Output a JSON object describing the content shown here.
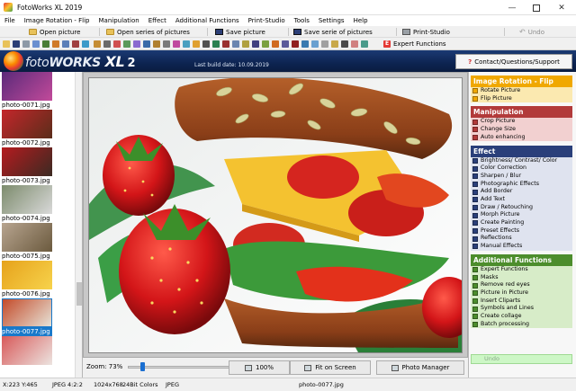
{
  "window": {
    "title": "FotoWorks XL 2019",
    "controls": {
      "minimize": "—",
      "close": "✕"
    }
  },
  "menu": [
    "File",
    "Image Rotation - Flip",
    "Manipulation",
    "Effect",
    "Additional Functions",
    "Print-Studio",
    "Tools",
    "Settings",
    "Help"
  ],
  "toolbar": {
    "open_picture": "Open picture",
    "open_series": "Open series of pictures",
    "save_picture": "Save picture",
    "save_series": "Save serie of pictures",
    "print_studio": "Print-Studio",
    "undo": "Undo",
    "expert_functions": "Expert Functions"
  },
  "banner": {
    "logo_foto": "foto",
    "logo_works": "WORKS",
    "logo_xl": "XL",
    "logo_version": "2",
    "build_date": "Last build date: 10.09.2019",
    "contact_label": "Contact/Questions/Support",
    "contact_icon": "?"
  },
  "thumbnails": [
    {
      "caption": "photo-0071.jpg",
      "colors": [
        "#5b2a7a",
        "#c24a9a"
      ]
    },
    {
      "caption": "photo-0072.jpg",
      "colors": [
        "#c4262b",
        "#5a2d1a"
      ]
    },
    {
      "caption": "photo-0073.jpg",
      "colors": [
        "#b51b1f",
        "#3b2a22"
      ]
    },
    {
      "caption": "photo-0074.jpg",
      "colors": [
        "#7c8b6c",
        "#d9d9d9"
      ]
    },
    {
      "caption": "photo-0075.jpg",
      "colors": [
        "#b7a48f",
        "#6b5a3e"
      ]
    },
    {
      "caption": "photo-0076.jpg",
      "colors": [
        "#e6a21b",
        "#f7d34c"
      ]
    },
    {
      "caption": "photo-0077.jpg",
      "colors": [
        "#c44b2a",
        "#e6e2d6"
      ],
      "selected": true
    },
    {
      "caption": "",
      "colors": [
        "#d85a5a",
        "#ece4e0"
      ]
    }
  ],
  "zoom": {
    "label": "Zoom: 73%",
    "value": 0.73,
    "btn_100": "100%",
    "btn_fit": "Fit on Screen",
    "btn_manager": "Photo Manager"
  },
  "panel": {
    "sections": [
      {
        "title": "Image Rotation - Flip",
        "header_color": "#f0a800",
        "body_color": "#fbe9b0",
        "items": [
          "Rotate Picture",
          "Flip Picture"
        ]
      },
      {
        "title": "Manipulation",
        "header_color": "#b23a3a",
        "body_color": "#f2d0d0",
        "items": [
          "Crop Picture",
          "Change Size",
          "Auto enhancing"
        ]
      },
      {
        "title": "Effect",
        "header_color": "#2a3f7a",
        "body_color": "#dfe3ef",
        "items": [
          "Brightness/ Contrast/ Color",
          "Color Correction",
          "Sharpen / Blur",
          "Photographic Effects",
          "Add Border",
          "Add Text",
          "Draw / Retouching",
          "Morph Picture",
          "Create Painting",
          "Preset Effects",
          "Reflections",
          "Manual Effects"
        ]
      },
      {
        "title": "Additional Functions",
        "header_color": "#4c8d2c",
        "body_color": "#d7ecc8",
        "items": [
          "Expert Functions",
          "Masks",
          "Remove red eyes",
          "Picture in Picture",
          "Insert Cliparts",
          "Symbols and Lines",
          "Create collage",
          "Batch processing"
        ]
      }
    ],
    "undo": "Undo"
  },
  "status": {
    "coords": "X:223 Y:465",
    "format": "JPEG  4:2:2",
    "dimensions": "1024x768",
    "colors": "24Bit Colors",
    "type": "JPEG",
    "filename": "photo-0077.jpg"
  }
}
